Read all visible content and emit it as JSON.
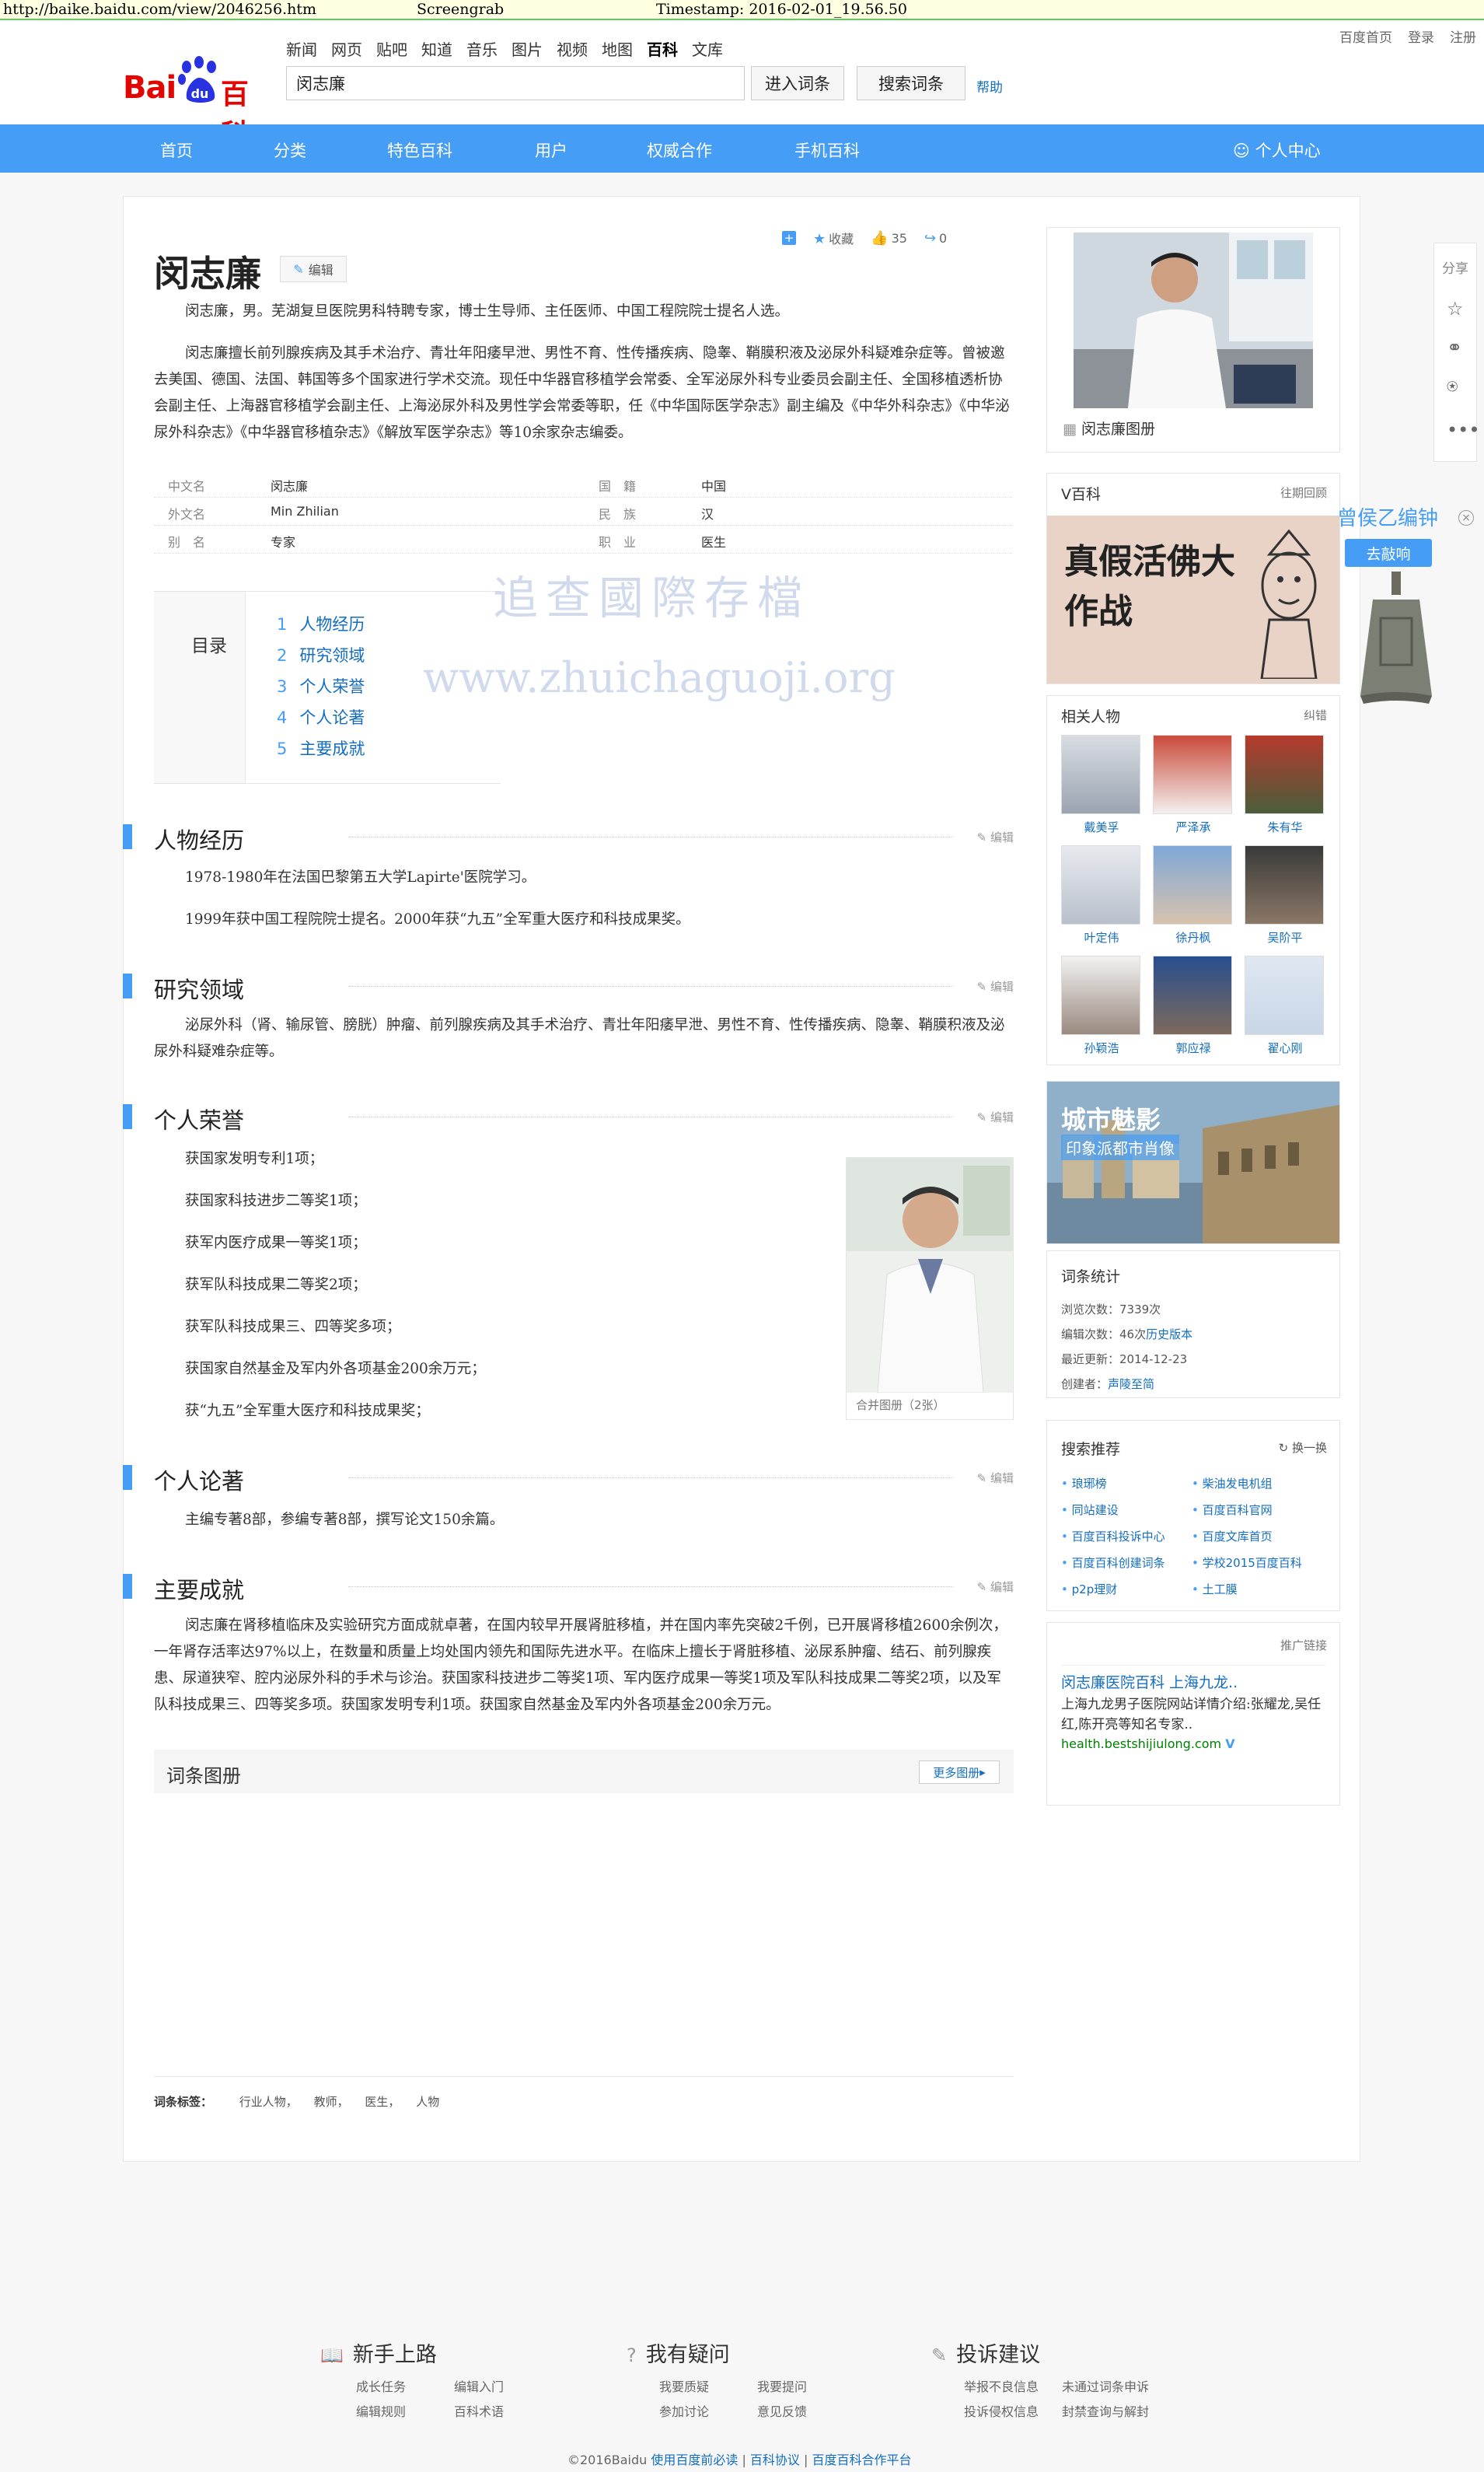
{
  "capture": {
    "url": "http://baike.baidu.com/view/2046256.htm",
    "label": "Screengrab",
    "timestamp": "Timestamp: 2016-02-01_19.56.50"
  },
  "header": {
    "top_links": [
      "百度首页",
      "登录",
      "注册"
    ],
    "logo": {
      "bai": "Bai",
      "du": "du",
      "baike": "百科"
    },
    "nav": [
      "新闻",
      "网页",
      "贴吧",
      "知道",
      "音乐",
      "图片",
      "视频",
      "地图",
      "百科",
      "文库"
    ],
    "active_nav": "百科",
    "search_value": "闵志廉",
    "btn_enter": "进入词条",
    "btn_search": "搜索词条",
    "help": "帮助"
  },
  "bluenav": {
    "items": [
      "首页",
      "分类",
      "特色百科",
      "用户",
      "权威合作",
      "手机百科"
    ],
    "personal": "个人中心"
  },
  "entry": {
    "title": "闵志廉",
    "edit": "编辑",
    "actions": {
      "collect": "收藏",
      "likes": "35",
      "shares": "0"
    },
    "summary_1": "闵志廉，男。芜湖复旦医院男科特聘专家，博士生导师、主任医师、中国工程院院士提名人选。",
    "summary_2": "闵志廉擅长前列腺疾病及其手术治疗、青壮年阳痿早泄、男性不育、性传播疾病、隐睾、鞘膜积液及泌尿外科疑难杂症等。曾被邀去美国、德国、法国、韩国等多个国家进行学术交流。现任中华器官移植学会常委、全军泌尿外科专业委员会副主任、全国移植透析协会副主任、上海器官移植学会副主任、上海泌尿外科及男性学会常委等职，任《中华国际医学杂志》副主编及《中华外科杂志》《中华泌尿外科杂志》《中华器官移植杂志》《解放军医学杂志》等10余家杂志编委。"
  },
  "basic_info": [
    {
      "label": "中文名",
      "value": "闵志廉"
    },
    {
      "label": "外文名",
      "value": "Min Zhilian"
    },
    {
      "label": "别　名",
      "value": "专家"
    },
    {
      "label": "国　籍",
      "value": "中国"
    },
    {
      "label": "民　族",
      "value": "汉"
    },
    {
      "label": "职　业",
      "value": "医生"
    }
  ],
  "catalog": {
    "label": "目录",
    "items": [
      {
        "n": "1",
        "t": "人物经历"
      },
      {
        "n": "2",
        "t": "研究领域"
      },
      {
        "n": "3",
        "t": "个人荣誉"
      },
      {
        "n": "4",
        "t": "个人论著"
      },
      {
        "n": "5",
        "t": "主要成就"
      }
    ]
  },
  "watermark": {
    "cn": "追查國際存檔",
    "url": "www.zhuichaguoji.org"
  },
  "sections": {
    "edit": "编辑",
    "s1": {
      "title": "人物经历",
      "p1": "1978-1980年在法国巴黎第五大学Lapirte'医院学习。",
      "p2": "1999年获中国工程院院士提名。2000年获“九五”全军重大医疗和科技成果奖。"
    },
    "s2": {
      "title": "研究领域",
      "p1": "泌尿外科（肾、输尿管、膀胱）肿瘤、前列腺疾病及其手术治疗、青壮年阳痿早泄、男性不育、性传播疾病、隐睾、鞘膜积液及泌尿外科疑难杂症等。"
    },
    "s3": {
      "title": "个人荣誉",
      "items": [
        "获国家发明专利1项；",
        "获国家科技进步二等奖1项；",
        "获军内医疗成果一等奖1项；",
        "获军队科技成果二等奖2项；",
        "获军队科技成果三、四等奖多项；",
        "获国家自然基金及军内外各项基金200余万元；",
        "获“九五”全军重大医疗和科技成果奖；"
      ],
      "photo_caption": "合并图册（2张）"
    },
    "s4": {
      "title": "个人论著",
      "p1": "主编专著8部，参编专著8部，撰写论文150余篇。"
    },
    "s5": {
      "title": "主要成就",
      "p1": "闵志廉在肾移植临床及实验研究方面成就卓著，在国内较早开展肾脏移植，并在国内率先突破2千例，已开展肾移植2600余例次，一年肾存活率达97%以上，在数量和质量上均处国内领先和国际先进水平。在临床上擅长于肾脏移植、泌尿系肿瘤、结石、前列腺疾患、尿道狭窄、腔内泌尿外科的手术与诊治。获国家科技进步二等奖1项、军内医疗成果一等奖1项及军队科技成果二等奖2项，以及军队科技成果三、四等奖多项。获国家发明专利1项。获国家自然基金及军内外各项基金200余万元。"
    }
  },
  "album": {
    "title": "词条图册",
    "more": "更多图册"
  },
  "tags": {
    "label": "词条标签：",
    "items": [
      "行业人物，",
      "教师，",
      "医生，",
      "人物"
    ]
  },
  "right": {
    "album_link": "闵志廉图册",
    "vbaike": {
      "title": "V百科",
      "link": "往期回顾",
      "banner": "真假活佛大作战"
    },
    "related": {
      "title": "相关人物",
      "link": "纠错",
      "people": [
        "戴美孚",
        "严泽承",
        "朱有华",
        "叶定伟",
        "徐丹枫",
        "吴阶平",
        "孙颖浩",
        "郭应禄",
        "翟心刚"
      ]
    },
    "city": {
      "title": "城市魅影",
      "sub": "印象派都市肖像"
    },
    "stats": {
      "title": "词条统计",
      "views": "浏览次数：7339次",
      "edits_prefix": "编辑次数：46次",
      "edits_link": "历史版本",
      "updated": "最近更新：2014-12-23",
      "creator_prefix": "创建者：",
      "creator_link": "声陵至简"
    },
    "recommend": {
      "title": "搜索推荐",
      "refresh": "换一换",
      "items": [
        "琅琊榜",
        "柴油发电机组",
        "同站建设",
        "百度百科官网",
        "百度百科投诉中心",
        "百度文库首页",
        "百度百科创建词条",
        "学校2015百度百科",
        "p2p理财",
        "土工膜"
      ]
    },
    "ad": {
      "label": "推广链接",
      "title": "闵志廉医院百科 上海九龙..",
      "desc": "上海九龙男子医院网站详情介绍:张耀龙,吴任红,陈开亮等知名专家..",
      "url": "health.bestshijiulong.com"
    }
  },
  "float": {
    "share": "分享",
    "ad_name": "曾侯乙编钟",
    "ad_btn": "去敲响"
  },
  "footer": {
    "g1": {
      "title": "新手上路",
      "links": [
        "成长任务",
        "编辑入门",
        "编辑规则",
        "百科术语"
      ]
    },
    "g2": {
      "title": "我有疑问",
      "links": [
        "我要质疑",
        "我要提问",
        "参加讨论",
        "意见反馈"
      ]
    },
    "g3": {
      "title": "投诉建议",
      "links": [
        "举报不良信息",
        "未通过词条申诉",
        "投诉侵权信息",
        "封禁查询与解封"
      ]
    },
    "copyright": "©2016Baidu",
    "c1": "使用百度前必读",
    "c2": "百科协议",
    "c3": "百度百科合作平台"
  },
  "colors": {
    "accent": "#459df5",
    "link": "#136ec2",
    "logo_red": "#e10602",
    "logo_blue": "#2932e1"
  }
}
